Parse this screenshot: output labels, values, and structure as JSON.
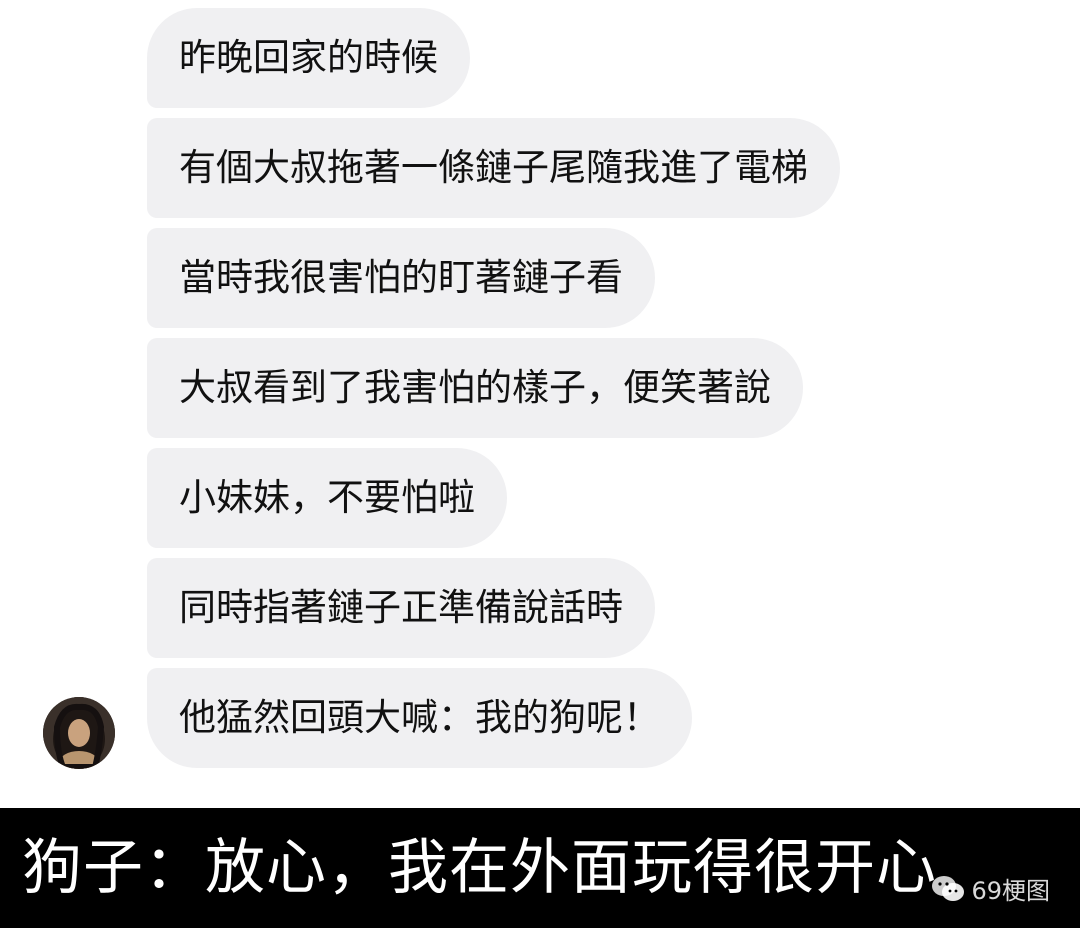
{
  "messages": [
    {
      "text": "昨晚回家的時候"
    },
    {
      "text": "有個大叔拖著一條鏈子尾隨我進了電梯"
    },
    {
      "text": "當時我很害怕的盯著鏈子看"
    },
    {
      "text": "大叔看到了我害怕的樣子，便笑著說"
    },
    {
      "text": "小妹妹，不要怕啦"
    },
    {
      "text": "同時指著鏈子正準備說話時"
    },
    {
      "text": "他猛然回頭大喊：我的狗呢！"
    }
  ],
  "caption": {
    "text": "狗子：放心，我在外面玩得很开心"
  },
  "watermark": {
    "text": "69梗图",
    "icon": "wechat-icon"
  },
  "colors": {
    "bubble": "#f0f0f2",
    "caption_bg": "#000000",
    "caption_text": "#ffffff"
  }
}
